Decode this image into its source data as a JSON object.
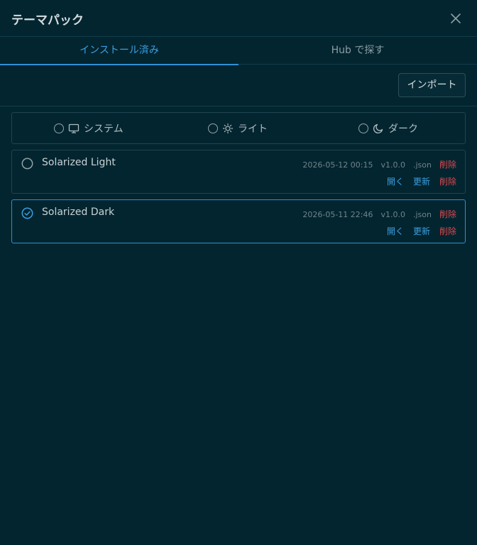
{
  "dialog": {
    "title": "テーマパック"
  },
  "tabs": [
    {
      "label": "インストール済み",
      "active": true
    },
    {
      "label": "Hub で探す",
      "active": false
    }
  ],
  "toolbar": {
    "import_label": "インポート"
  },
  "modes": [
    {
      "label": "システム",
      "icon": "monitor-icon",
      "selected": false
    },
    {
      "label": "ライト",
      "icon": "sun-icon",
      "selected": false
    },
    {
      "label": "ダーク",
      "icon": "moon-icon",
      "selected": false
    }
  ],
  "themes": [
    {
      "name": "Solarized Light",
      "date": "2026-05-12 00:15",
      "version": "v1.0.0",
      "ext": ".json",
      "delete_label": "削除",
      "actions": {
        "open": "開く",
        "update": "更新",
        "delete": "削除"
      },
      "selected": false
    },
    {
      "name": "Solarized Dark",
      "date": "2026-05-11 22:46",
      "version": "v1.0.0",
      "ext": ".json",
      "delete_label": "削除",
      "actions": {
        "open": "開く",
        "update": "更新",
        "delete": "削除"
      },
      "selected": true
    }
  ],
  "colors": {
    "background": "#032530",
    "accent": "#3b9fe0",
    "danger": "#e0474c",
    "border": "#1f4550"
  }
}
